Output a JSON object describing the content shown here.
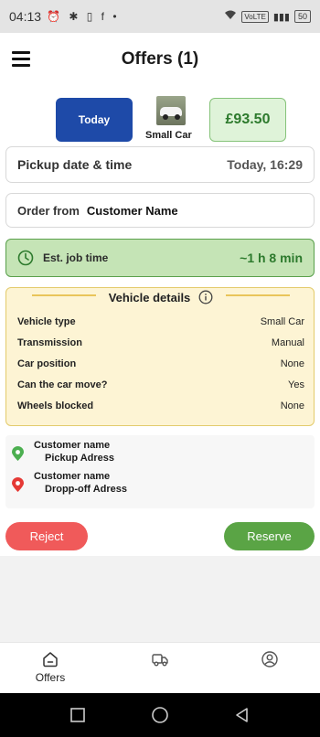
{
  "statusbar": {
    "time": "04:13",
    "left_icons": "⏰ ✱ ▯ f •",
    "volte": "VoLTE",
    "signal": "▮▮▮",
    "battery": "50"
  },
  "header": {
    "title": "Offers (1)"
  },
  "offer": {
    "today_label": "Today",
    "car_type": "Small Car",
    "price": "£93.50"
  },
  "pickup": {
    "label": "Pickup date & time",
    "value": "Today, 16:29"
  },
  "order": {
    "label": "Order from",
    "customer": "Customer Name"
  },
  "estimate": {
    "label": "Est. job time",
    "value": "~1 h 8 min"
  },
  "vehicle_details": {
    "title": "Vehicle details",
    "rows": [
      {
        "label": "Vehicle type",
        "value": "Small Car"
      },
      {
        "label": "Transmission",
        "value": "Manual"
      },
      {
        "label": "Car position",
        "value": "None"
      },
      {
        "label": "Can the car move?",
        "value": "Yes"
      },
      {
        "label": "Wheels blocked",
        "value": "None"
      }
    ]
  },
  "addresses": {
    "pickup": {
      "name": "Customer name",
      "address": "Pickup Adress"
    },
    "dropoff": {
      "name": "Customer name",
      "address": "Dropp-off Adress"
    }
  },
  "actions": {
    "reject_label": "Reject",
    "reserve_label": "Reserve"
  },
  "bottom_nav": {
    "offers_label": "Offers"
  },
  "colors": {
    "primary_blue": "#1e4aa8",
    "success_green": "#5aa445",
    "price_green": "#2d7a2d",
    "reject_red": "#f05a5a",
    "pickup_pin": "#4caf50",
    "dropoff_pin": "#e53935",
    "vehicle_card_bg": "#fdf4d4"
  }
}
